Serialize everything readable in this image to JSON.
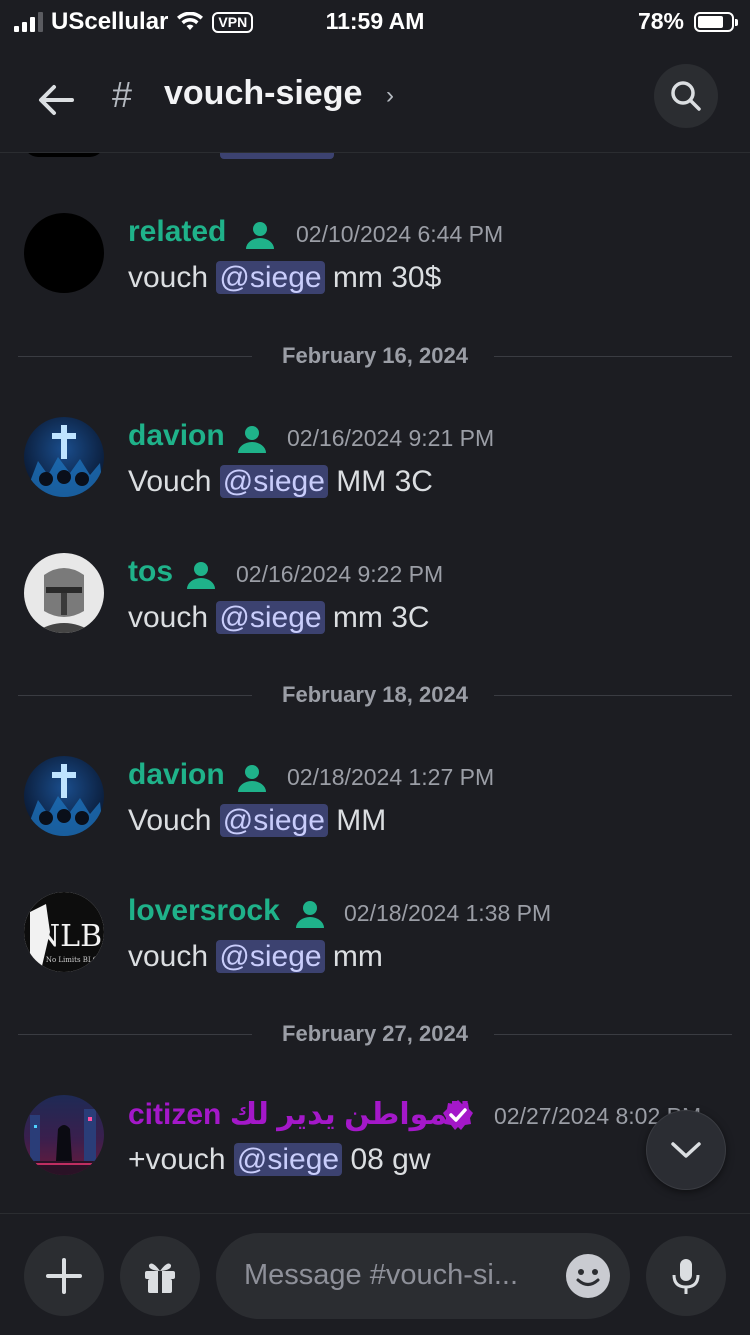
{
  "status_bar": {
    "carrier": "UScellular",
    "vpn": "VPN",
    "time": "11:59 AM",
    "battery": "78%",
    "battery_level": 0.78
  },
  "header": {
    "hash": "#",
    "channel_name": "vouch-siege",
    "chevron": "›"
  },
  "colors": {
    "accent_green": "#23a55a",
    "username_teal": "#1fb28a",
    "username_purple": "#a418c9",
    "mention_bg": "#3c4270"
  },
  "messages": [
    {
      "username": "related",
      "timestamp": "02/10/2024 6:44 PM",
      "prefix": "vouch ",
      "mention": "@siege",
      "suffix": " mm 30$"
    },
    {
      "username": "davion",
      "timestamp": "02/16/2024 9:21 PM",
      "prefix": "Vouch ",
      "mention": "@siege",
      "suffix": " MM 3C"
    },
    {
      "username": "tos",
      "timestamp": "02/16/2024 9:22 PM",
      "prefix": "vouch ",
      "mention": "@siege",
      "suffix": " mm 3C"
    },
    {
      "username": "davion",
      "timestamp": "02/18/2024 1:27 PM",
      "prefix": "Vouch ",
      "mention": "@siege",
      "suffix": " MM"
    },
    {
      "username": "loversrock",
      "timestamp": "02/18/2024 1:38 PM",
      "prefix": "vouch ",
      "mention": "@siege",
      "suffix": " mm"
    },
    {
      "username": "citizen المواطن يدير لك",
      "timestamp": "02/27/2024 8:02 PM",
      "prefix": "+vouch ",
      "mention": "@siege",
      "suffix": " 08 gw"
    }
  ],
  "dividers": [
    "February 16, 2024",
    "February 18, 2024",
    "February 27, 2024"
  ],
  "avatars": {
    "loversrock_text": "NLB",
    "loversrock_sub": "No Limits BLG"
  },
  "composer": {
    "placeholder": "Message #vouch-si...",
    "icons": [
      "plus-icon",
      "gift-icon",
      "emoji-icon",
      "microphone-icon"
    ]
  }
}
